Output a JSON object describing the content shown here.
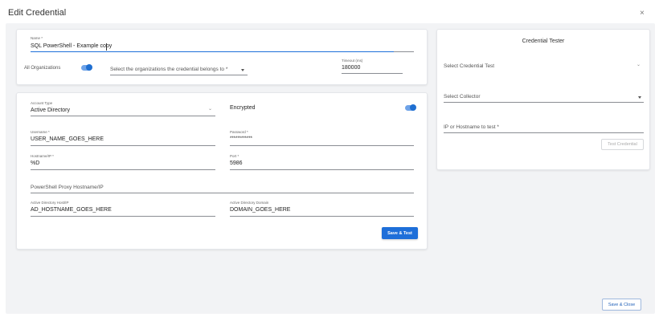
{
  "dialog": {
    "title": "Edit Credential",
    "close_glyph": "×"
  },
  "general": {
    "name_label": "Name *",
    "name_value": "SQL PowerShell - Example copy",
    "all_orgs_label": "All Organizations",
    "all_orgs_on": true,
    "orgs_placeholder": "Select the organizations the credential belongs to *",
    "timeout_label": "Timeout (ms)",
    "timeout_value": "180000"
  },
  "account": {
    "account_type_label": "Account Type",
    "account_type_value": "Active Directory",
    "encrypted_label": "Encrypted",
    "encrypted_on": true,
    "username_label": "Username *",
    "username_value": "USER_NAME_GOES_HERE",
    "password_label": "Password *",
    "password_value": "************",
    "hostname_label": "Hostname/IP *",
    "hostname_value": "%D",
    "port_label": "Port *",
    "port_value": "5986",
    "proxy_placeholder": "PowerShell Proxy Hostname/IP",
    "ad_host_label": "Active Directory Host/IP",
    "ad_host_value": "AD_HOSTNAME_GOES_HERE",
    "ad_domain_label": "Active Directory Domain",
    "ad_domain_value": "DOMAIN_GOES_HERE",
    "save_test_label": "Save & Test"
  },
  "tester": {
    "title": "Credential Tester",
    "select_test_placeholder": "Select Credential Test",
    "select_collector_placeholder": "Select Collector",
    "ip_placeholder": "IP or Hostname to test *",
    "test_button_label": "Test Credential"
  },
  "footer": {
    "save_close_label": "Save & Close"
  },
  "colors": {
    "accent": "#1e6fd9",
    "panel_bg": "#f2f3f5"
  }
}
